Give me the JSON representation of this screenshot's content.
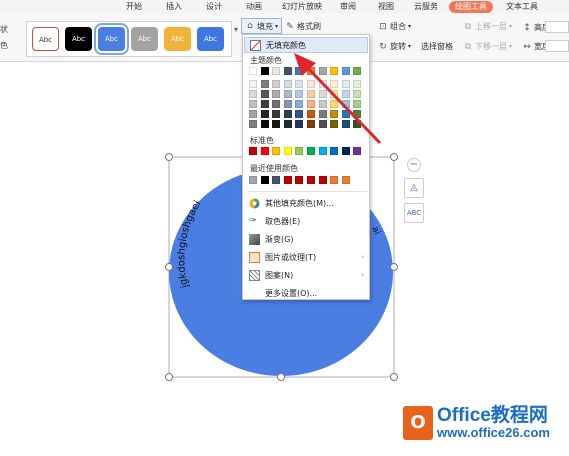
{
  "ribbon": {
    "tabs": [
      "开始",
      "插入",
      "设计",
      "动画",
      "幻灯片放映",
      "审阅",
      "视图",
      "云服务",
      "绘图工具",
      "文本工具"
    ],
    "active_tab": "绘图工具",
    "left_truncated": [
      "状",
      "色"
    ],
    "style_label": "Abc",
    "fill_label": "填充",
    "format_brush_label": "格式刷",
    "group_label": "组合",
    "rotate_label": "旋转",
    "selection_pane_label": "选择窗格",
    "bring_forward_label": "上移一层",
    "send_backward_label": "下移一层",
    "height_label": "高度:",
    "width_label": "宽度:"
  },
  "dropdown": {
    "no_fill": "无填充颜色",
    "theme_colors": "主题颜色",
    "standard_colors": "标准色",
    "recent_colors": "最近使用颜色",
    "other_fill": "其他填充颜色(M)...",
    "eyedropper": "取色器(E)",
    "gradient": "渐变(G)",
    "picture_texture": "图片或纹理(T)",
    "pattern": "图案(N)",
    "more_settings": "更多设置(O)..."
  },
  "shape": {
    "text_left": "jgkdoshgioshgaei",
    "text_right": "ai"
  },
  "watermark": {
    "logo_glyph": "O",
    "line1": "Office教程网",
    "line2": "www.office26.com"
  },
  "colors": {
    "accent": "#f17856",
    "shape_fill": "#4a7ee3",
    "arrow": "#e0262d"
  }
}
